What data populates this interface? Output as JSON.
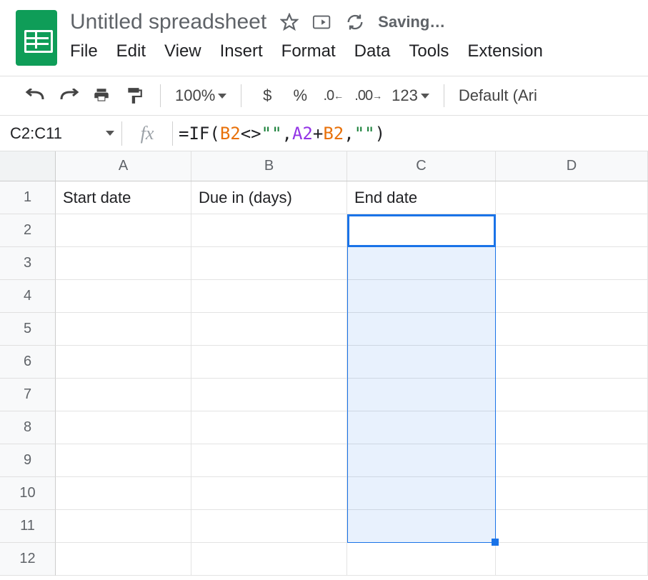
{
  "header": {
    "doc_title": "Untitled spreadsheet",
    "status": "Saving…"
  },
  "menubar": {
    "items": [
      "File",
      "Edit",
      "View",
      "Insert",
      "Format",
      "Data",
      "Tools",
      "Extension"
    ]
  },
  "toolbar": {
    "zoom": "100%",
    "currency": "$",
    "percent": "%",
    "dec_decrease": ".0",
    "dec_increase": ".00",
    "more_formats": "123",
    "font": "Default (Ari"
  },
  "namebox": "C2:C11",
  "formula": {
    "fn_open": "=IF",
    "lparen": "(",
    "ref_b2_1": "B2",
    "neq": "<>",
    "empty1_q1": "\"",
    "empty1_q2": "\"",
    "comma1": ",",
    "ref_a2": "A2",
    "plus": "+",
    "ref_b2_2": "B2",
    "comma2": ",",
    "empty2_q1": "\"",
    "empty2_q2": "\"",
    "rparen": ")"
  },
  "columns": [
    "A",
    "B",
    "C",
    "D"
  ],
  "rows": [
    "1",
    "2",
    "3",
    "4",
    "5",
    "6",
    "7",
    "8",
    "9",
    "10",
    "11",
    "12"
  ],
  "cells": {
    "A1": "Start date",
    "B1": "Due in (days)",
    "C1": "End date"
  },
  "selection": {
    "range": "C2:C11",
    "active": "C2"
  }
}
